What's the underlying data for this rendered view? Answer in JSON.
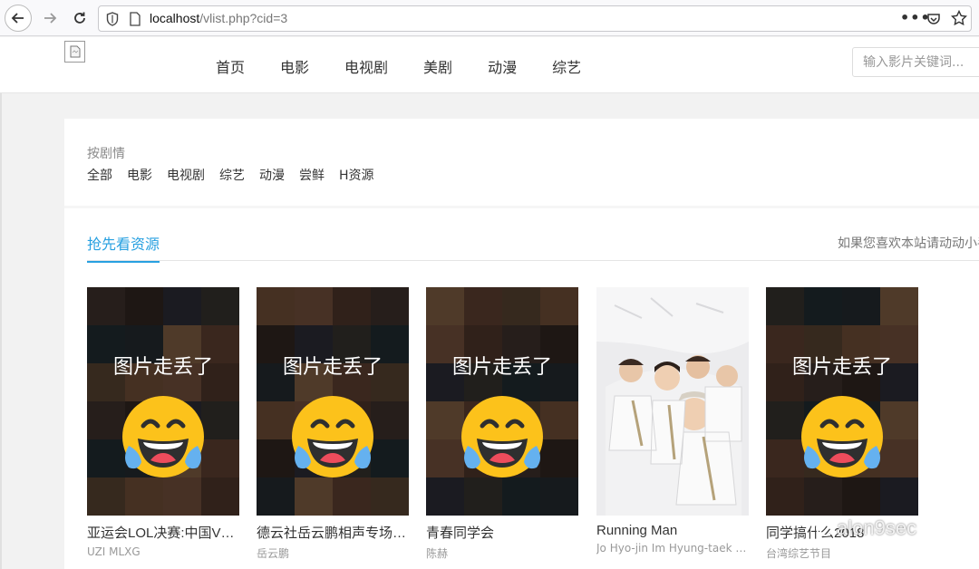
{
  "browser": {
    "url_host": "localhost",
    "url_path": "/vlist.php?cid=3",
    "more_label": "•••"
  },
  "header": {
    "nav": [
      "首页",
      "电影",
      "电视剧",
      "美剧",
      "动漫",
      "综艺"
    ],
    "search_placeholder": "输入影片关键词..."
  },
  "filter": {
    "title": "按剧情",
    "items": [
      "全部",
      "电影",
      "电视剧",
      "综艺",
      "动漫",
      "尝鲜",
      "H资源"
    ]
  },
  "section": {
    "tab_label": "抢先看资源",
    "note": "如果您喜欢本站请动动小手"
  },
  "cards": [
    {
      "title": "亚运会LOL决赛:中国VS韩国",
      "sub": "UZI MLXG",
      "overlay": "图片走丢了"
    },
    {
      "title": "德云社岳云鹏相声专场游记",
      "sub": "岳云鹏",
      "overlay": "图片走丢了"
    },
    {
      "title": "青春同学会",
      "sub": "陈赫",
      "overlay": "图片走丢了"
    },
    {
      "title": "Running Man",
      "sub": "Jo Hyo-jin Im Hyung-taek Kim Jong-kook",
      "overlay": ""
    },
    {
      "title": "同学搞什么2018",
      "sub": "台湾综艺节目",
      "overlay": "图片走丢了"
    }
  ],
  "watermark": "alon9sec",
  "colors": {
    "accent": "#27a0e0",
    "header_bg": "#ffffff",
    "page_bg": "#f2f2f2"
  },
  "icons": {
    "back": "arrow-left-icon",
    "forward": "arrow-right-icon",
    "reload": "reload-icon",
    "shield": "shield-icon",
    "page": "page-icon",
    "pocket": "pocket-icon",
    "star": "star-icon",
    "broken_image": "broken-image-icon",
    "emoji": "tears-of-joy-emoji-icon"
  }
}
